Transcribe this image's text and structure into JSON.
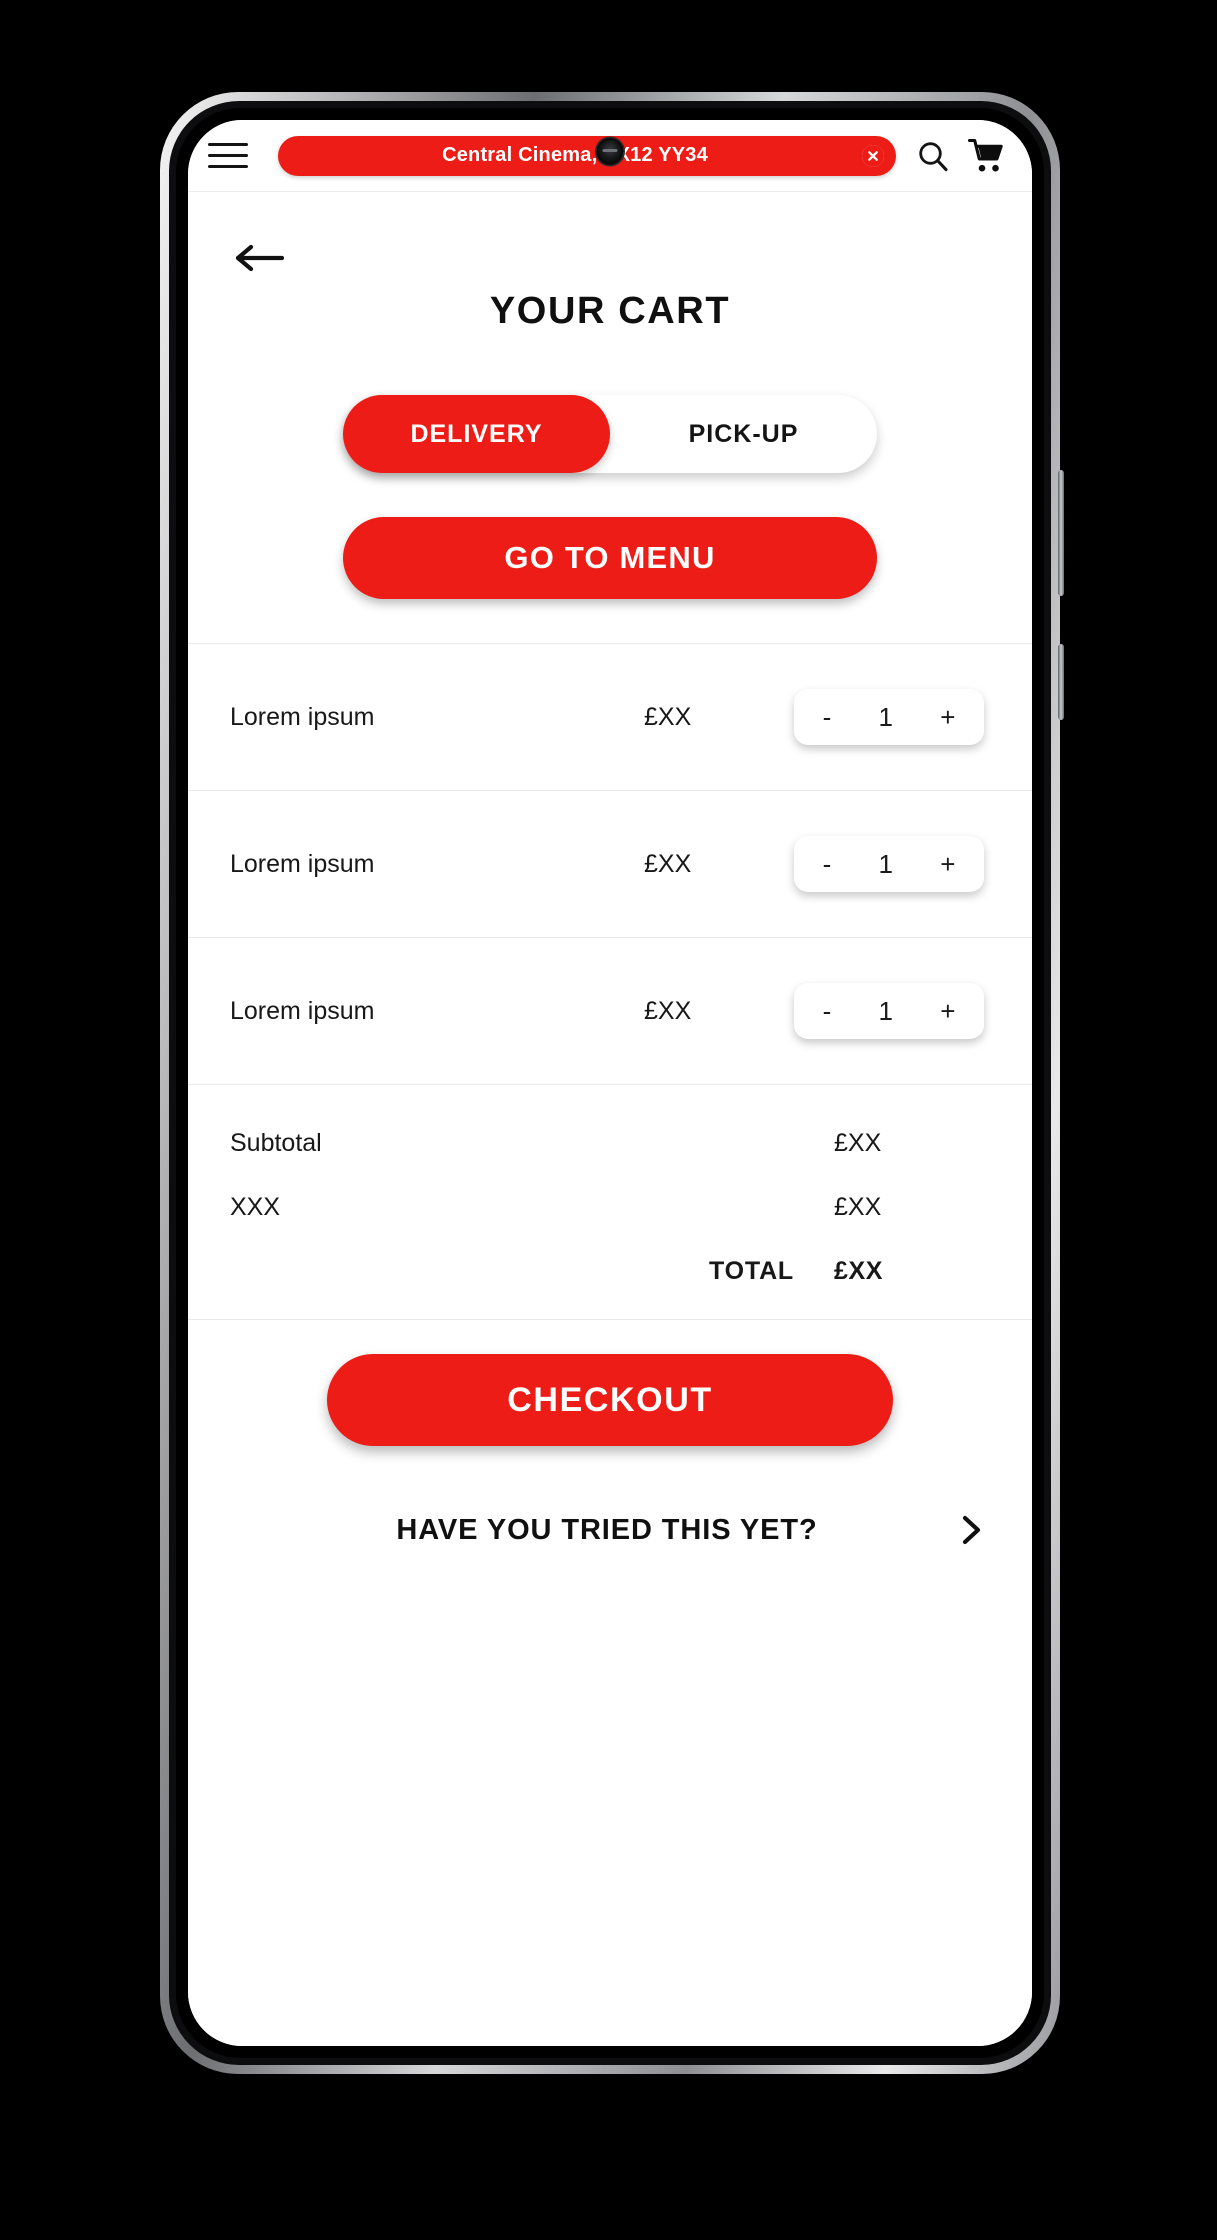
{
  "header": {
    "menu_icon": "hamburger-menu-icon",
    "location_text": "Central Cinema, XX12 YY34",
    "clear_icon": "close-circle-icon",
    "search_icon": "search-icon",
    "cart_icon": "shopping-cart-icon"
  },
  "nav": {
    "back_icon": "arrow-left-icon",
    "title": "YOUR CART"
  },
  "fulfilment": {
    "options": [
      {
        "label": "DELIVERY",
        "active": true
      },
      {
        "label": "PICK-UP",
        "active": false
      }
    ]
  },
  "actions": {
    "go_to_menu": "GO TO MENU",
    "checkout": "CHECKOUT"
  },
  "cart": {
    "items": [
      {
        "name": "Lorem ipsum",
        "price": "£XX",
        "minus": "-",
        "qty": "1",
        "plus": "+"
      },
      {
        "name": "Lorem ipsum",
        "price": "£XX",
        "minus": "-",
        "qty": "1",
        "plus": "+"
      },
      {
        "name": "Lorem ipsum",
        "price": "£XX",
        "minus": "-",
        "qty": "1",
        "plus": "+"
      }
    ]
  },
  "totals": {
    "subtotal_label": "Subtotal",
    "subtotal_value": "£XX",
    "extra_label": "XXX",
    "extra_value": "£XX",
    "total_label": "TOTAL",
    "total_value": "£XX"
  },
  "footer": {
    "promo_text": "HAVE YOU TRIED THIS YET?",
    "chevron_icon": "chevron-right-icon"
  },
  "colors": {
    "brand_red": "#ED1C16",
    "text_dark": "#101010",
    "divider": "#e9e9e9",
    "surface": "#ffffff"
  }
}
